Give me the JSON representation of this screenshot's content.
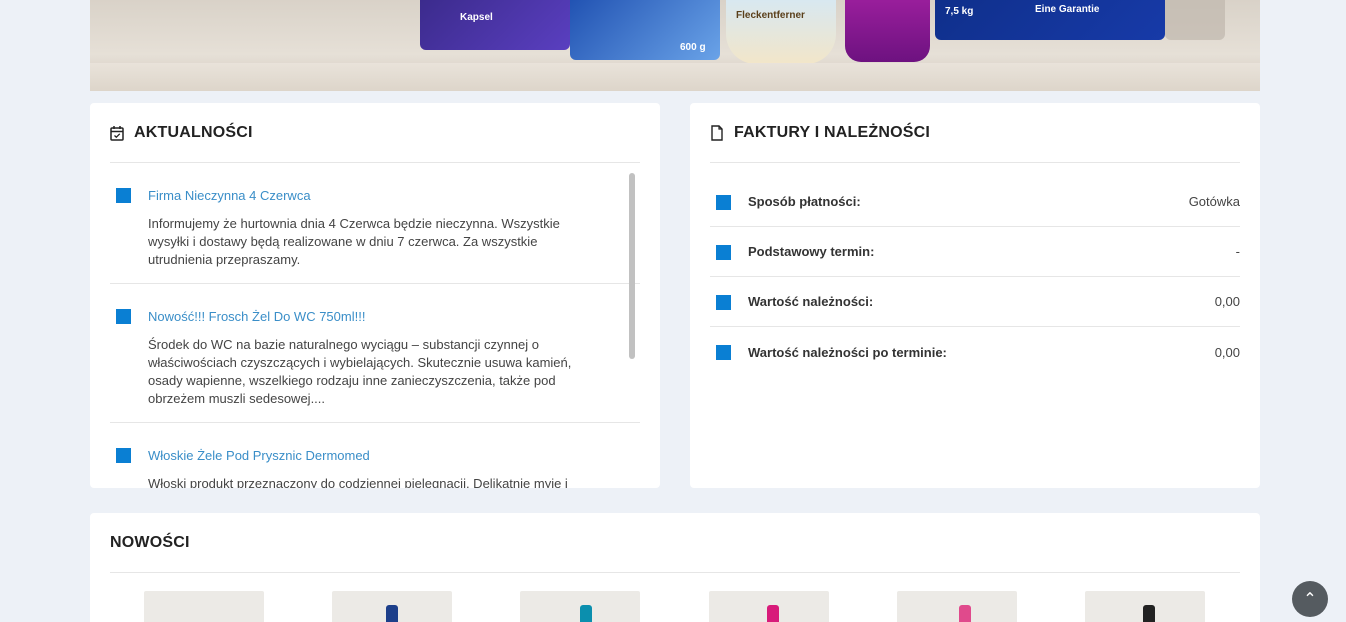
{
  "colors": {
    "accent": "#0a7fd3",
    "link": "#3a8ec8",
    "background": "#edf1f7"
  },
  "banner": {
    "product_labels": [
      "Kapsel",
      "Fleckentferner",
      "7,5 kg",
      "600 g",
      "Eine Garantie"
    ]
  },
  "news": {
    "icon": "calendar-check-icon",
    "title": "AKTUALNOŚCI",
    "items": [
      {
        "title": "Firma Nieczynna 4 Czerwca",
        "body": "Informujemy że hurtownia dnia 4 Czerwca będzie nieczynna. Wszystkie wysyłki i dostawy będą realizowane w dniu 7 czerwca. Za wszystkie utrudnienia przepraszamy."
      },
      {
        "title": "Nowość!!! Frosch Żel Do WC 750ml!!!",
        "body": "Środek do WC na bazie naturalnego wyciągu – substancji czynnej o właściwościach czyszczących i wybielających. Skutecznie usuwa kamień, osady wapienne, wszelkiego rodzaju inne zanieczyszczenia, także pod obrzeżem muszli sedesowej...."
      },
      {
        "title": "Włoskie Żele Pod Prysznic Dermomed",
        "body": "Włoski produkt przeznaczony do codziennej pielęgnacji. Delikatnie myje i"
      }
    ]
  },
  "invoices": {
    "icon": "document-icon",
    "title": "FAKTURY I NALEŻNOŚCI",
    "rows": [
      {
        "label": "Sposób płatności:",
        "value": "Gotówka"
      },
      {
        "label": "Podstawowy termin:",
        "value": "-"
      },
      {
        "label": "Wartość należności:",
        "value": "0,00"
      },
      {
        "label": "Wartość należności po terminie:",
        "value": "0,00"
      }
    ]
  },
  "novelties": {
    "title": "NOWOŚCI",
    "bottle_colors": [
      "#1a5fb4",
      "#1d3f8a",
      "#0b8fae",
      "#d81b7a",
      "#e04a8c",
      "#222222"
    ]
  },
  "scroll_top": {
    "icon": "chevron-up-icon",
    "glyph": "⌃"
  }
}
